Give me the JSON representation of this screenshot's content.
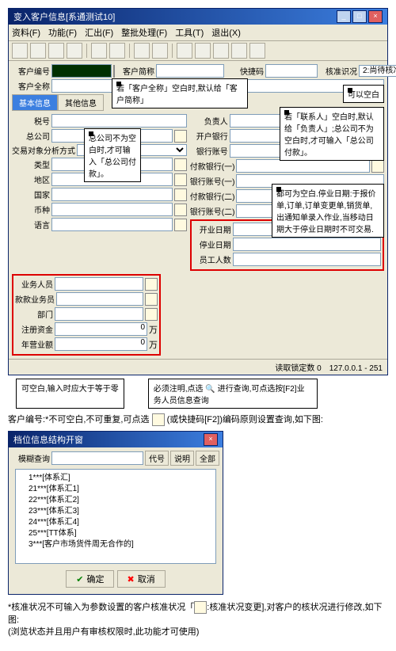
{
  "window1": {
    "title": "变入客户信息[系通测试10]",
    "menu": [
      "资料(F)",
      "功能(F)",
      "汇出(F)",
      "整批处理(F)",
      "工具(T)",
      "退出(X)"
    ],
    "quickbar": {
      "cust_no_lbl": "客户编号",
      "cust_abbr_lbl": "客户简称",
      "quickcode_lbl": "快捷码",
      "status_lbl": "核准识况",
      "status_sel": "2:尚待核准"
    },
    "tabs": {
      "active": "基本信息",
      "other": "其他信息"
    },
    "left_labels": {
      "tax": "税号",
      "hq": "总公司",
      "txbal": "交易对象分析方式",
      "cat": "类型",
      "area": "地区",
      "nation": "国家",
      "curr": "币种",
      "lang": "语言"
    },
    "mid_labels": {
      "bank": "开户银行",
      "acct": "银行账号",
      "paybank1": "付款银行(一)",
      "bankacct1": "银行账号(一)",
      "paybank2": "付款银行(二)",
      "bankacct2": "银行账号(二)",
      "startdate": "开业日期",
      "enddate": "停业日期",
      "emp": "员工人数"
    },
    "right_labels": {
      "contact": "负责人"
    },
    "bottom_labels": {
      "sales": "业务人员",
      "collector": "款款业务员",
      "dept": "部门",
      "reg": "注册资金",
      "annual": "年营业额",
      "unit": "万",
      "zero": "0"
    },
    "status": {
      "lock": "读取锁定数",
      "count": "0",
      "ip": "127.0.0.1 - 251"
    }
  },
  "callouts": {
    "c1": "若「客户全称」空白时,默认给「客户简称」",
    "c2": "可以空白",
    "c3": "总公司不为空白时,才可输入「总公司付款」。",
    "c4": "若「联系人」空白时,默认给「负责人」;总公司不为空白时,才可输入「总公司付款」。",
    "c5": "都可为空白.停业日期:于报价单,订单,订单变更单,销货单,出通知单录入作业,当移动日期大于停业日期时不可交易.",
    "c6": "可空白,输入时应大于等于零",
    "c7": "必须注明,点选 🔍 进行查询,可点选按[F2]业务人员信息查询"
  },
  "tip1": "客户编号:*不可空白,不可重复,可点选",
  "tip1b": "(或快捷码[F2])编码原则设置查询,如下图:",
  "window2": {
    "title": "档位信息结构开窗",
    "search_lbl": "模糊查询",
    "cols": {
      "a": "代号",
      "b": "说明"
    },
    "btn_all": "全部",
    "tree": [
      "1***[体系汇]",
      "21***[体系汇1]",
      "22***[体系汇2]",
      "23***[体系汇3]",
      "24***[体系汇4]",
      "25***[TT体系]",
      "3***[客户市场货件周无合作的]"
    ],
    "ok": "确定",
    "cancel": "取消"
  },
  "tip2a": "*核准状况不可输入为参数设置的客户核准状况「",
  "tip2b": ":核准状况变更],对客户的核状况进行修改,如下图:",
  "tip2c": "(浏览状态并且用户有审核权限时,此功能才可使用)"
}
